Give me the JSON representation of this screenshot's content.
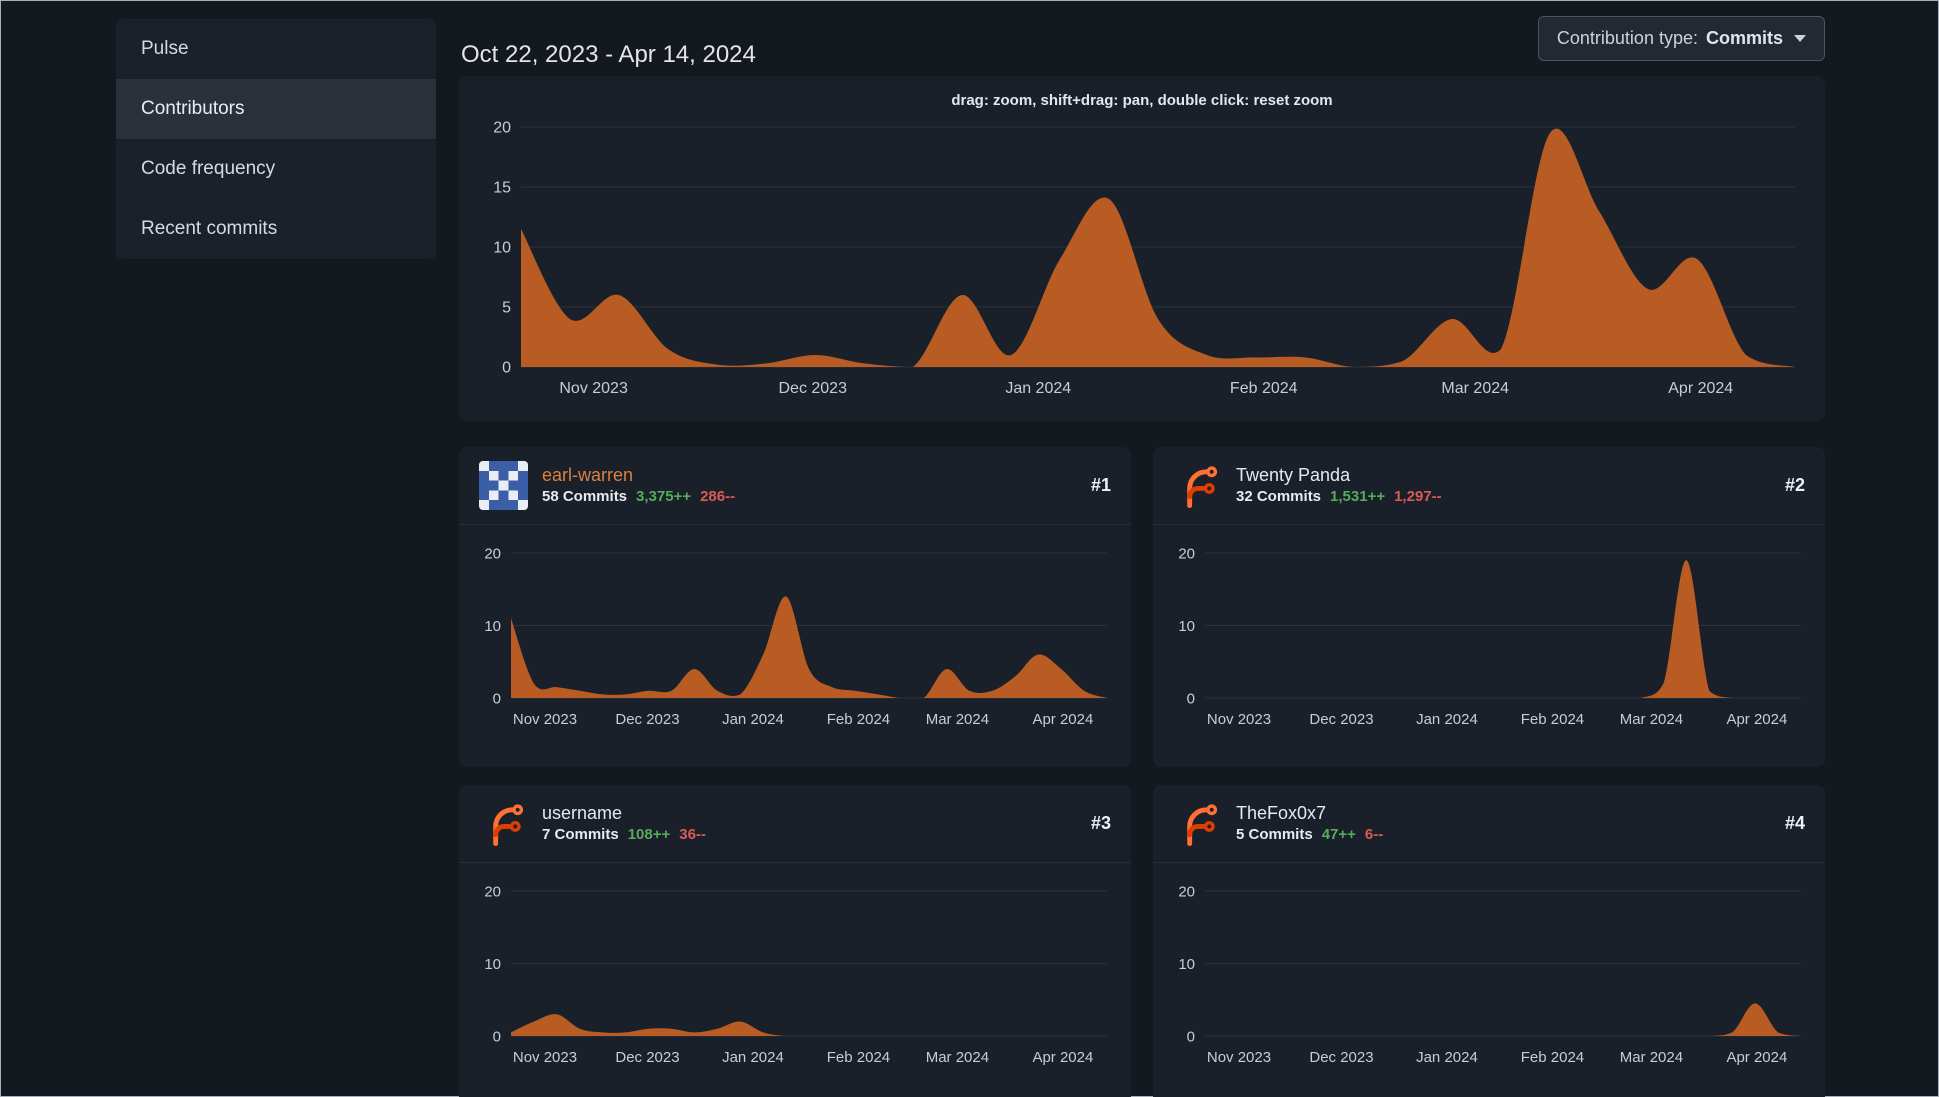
{
  "sidebar": {
    "items": [
      {
        "label": "Pulse",
        "active": false
      },
      {
        "label": "Contributors",
        "active": true
      },
      {
        "label": "Code frequency",
        "active": false
      },
      {
        "label": "Recent commits",
        "active": false
      }
    ]
  },
  "header": {
    "date_range": "Oct 22, 2023 - Apr 14, 2024",
    "contribution_type": {
      "label": "Contribution type:",
      "value": "Commits"
    }
  },
  "colors": {
    "area_fill": "#b85c24",
    "grid": "#2c323c",
    "additions": "#57ab5a",
    "deletions": "#da5a56",
    "link": "#dd8040"
  },
  "chart_data": {
    "type": "area",
    "hint": "drag: zoom, shift+drag: pan, double click: reset zoom",
    "x_axis_ticks": [
      {
        "pos": 0.057,
        "label": "Nov 2023"
      },
      {
        "pos": 0.229,
        "label": "Dec 2023"
      },
      {
        "pos": 0.406,
        "label": "Jan 2024"
      },
      {
        "pos": 0.583,
        "label": "Feb 2024"
      },
      {
        "pos": 0.749,
        "label": "Mar 2024"
      },
      {
        "pos": 0.926,
        "label": "Apr 2024"
      }
    ],
    "main": {
      "ymax": 20,
      "yticks": [
        0,
        5,
        10,
        15,
        20
      ],
      "values": [
        11.5,
        4,
        6,
        1.5,
        0.2,
        0.3,
        1,
        0.3,
        0,
        6,
        1,
        9,
        14,
        4,
        1,
        0.8,
        0.8,
        0,
        0.5,
        4,
        1.5,
        19.5,
        13,
        6.5,
        9,
        1,
        0
      ]
    }
  },
  "contributors": [
    {
      "rank": "#1",
      "name": "earl-warren",
      "commits": "58 Commits",
      "additions": "3,375++",
      "deletions": "286--",
      "avatar": "identicon",
      "chart": {
        "ymax": 20,
        "yticks": [
          0,
          10,
          20
        ],
        "values": [
          11,
          2,
          1.5,
          1,
          0.5,
          0.5,
          1,
          1,
          4,
          1,
          0.5,
          6,
          14,
          4,
          1.5,
          1,
          0.5,
          0,
          0,
          4,
          1,
          1,
          3,
          6,
          4,
          1,
          0
        ]
      }
    },
    {
      "rank": "#2",
      "name": "Twenty Panda",
      "commits": "32 Commits",
      "additions": "1,531++",
      "deletions": "1,297--",
      "avatar": "forgejo-logo",
      "chart": {
        "ymax": 20,
        "yticks": [
          0,
          10,
          20
        ],
        "values": [
          0,
          0,
          0,
          0,
          0,
          0,
          0,
          0,
          0,
          0,
          0,
          0,
          0,
          0,
          0,
          0,
          0,
          0,
          0,
          0,
          2,
          19,
          1,
          0,
          0,
          0,
          0
        ]
      }
    },
    {
      "rank": "#3",
      "name": "username",
      "commits": "7 Commits",
      "additions": "108++",
      "deletions": "36--",
      "avatar": "forgejo-logo",
      "chart": {
        "ymax": 20,
        "yticks": [
          0,
          10,
          20
        ],
        "values": [
          0.5,
          2,
          3,
          1,
          0.5,
          0.5,
          1,
          1,
          0.5,
          1,
          2,
          0.5,
          0,
          0,
          0,
          0,
          0,
          0,
          0,
          0,
          0,
          0,
          0,
          0,
          0,
          0,
          0
        ]
      }
    },
    {
      "rank": "#4",
      "name": "TheFox0x7",
      "commits": "5 Commits",
      "additions": "47++",
      "deletions": "6--",
      "avatar": "forgejo-logo",
      "chart": {
        "ymax": 20,
        "yticks": [
          0,
          10,
          20
        ],
        "values": [
          0,
          0,
          0,
          0,
          0,
          0,
          0,
          0,
          0,
          0,
          0,
          0,
          0,
          0,
          0,
          0,
          0,
          0,
          0,
          0,
          0,
          0,
          0,
          0.5,
          4.5,
          0.5,
          0
        ]
      }
    }
  ]
}
